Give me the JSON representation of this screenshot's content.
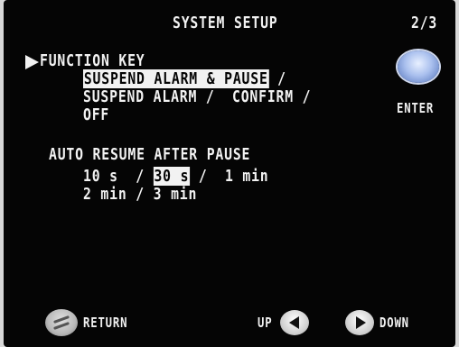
{
  "header": {
    "title": "SYSTEM SETUP",
    "page": "2/3"
  },
  "function_key": {
    "label": "FUNCTION KEY",
    "option_selected": "SUSPEND ALARM & PAUSE",
    "sep1": " /",
    "line2": "SUSPEND ALARM /  CONFIRM /",
    "option_off": "OFF"
  },
  "enter": {
    "label": "ENTER"
  },
  "auto_resume": {
    "label": "AUTO RESUME AFTER PAUSE",
    "opt_10s": "10 s  /",
    "opt_30s": "30 s",
    "opt_1min": " /  1 min",
    "opt_2min": "2 min /",
    "opt_3min": "3 min"
  },
  "footer": {
    "return_label": "RETURN",
    "up_label": "UP",
    "down_label": "DOWN"
  }
}
